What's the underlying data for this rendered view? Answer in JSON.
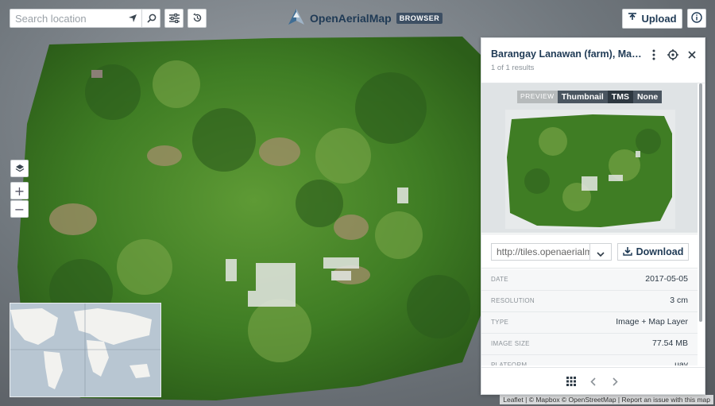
{
  "search": {
    "placeholder": "Search location"
  },
  "brand": {
    "name": "OpenAerialMap",
    "badge": "BROWSER"
  },
  "header": {
    "upload_label": "Upload"
  },
  "icons": {
    "locate": "locate-arrow-icon",
    "search": "search-icon",
    "filters": "sliders-icon",
    "history": "history-icon",
    "upload": "upload-icon",
    "info": "info-icon",
    "layers": "layers-icon",
    "zoom_in": "plus-icon",
    "zoom_out": "minus-icon",
    "more": "more-vertical-icon",
    "target": "crosshair-icon",
    "close": "close-icon",
    "grid": "grid-icon",
    "prev": "chevron-left-icon",
    "next": "chevron-right-icon",
    "dropdown": "chevron-down-icon",
    "download": "download-icon"
  },
  "map_controls": {
    "zoom_in_label": "+",
    "zoom_out_label": "−"
  },
  "panel": {
    "title": "Barangay Lanawan (farm), Mac...",
    "subtitle": "1 of 1 results",
    "preview_label": "PREVIEW",
    "preview_tabs": [
      {
        "label": "Thumbnail",
        "active": false
      },
      {
        "label": "TMS",
        "active": true
      },
      {
        "label": "None",
        "active": false
      }
    ],
    "tms_url": "http://tiles.openaerialmap.org",
    "download_label": "Download",
    "metadata": [
      {
        "key": "DATE",
        "value": "2017-05-05"
      },
      {
        "key": "RESOLUTION",
        "value": "3 cm"
      },
      {
        "key": "TYPE",
        "value": "Image + Map Layer"
      },
      {
        "key": "IMAGE SIZE",
        "value": "77.54 MB"
      },
      {
        "key": "PLATFORM",
        "value": "uav"
      }
    ]
  },
  "attribution": "Leaflet | © Mapbox © OpenStreetMap | Report an issue with this map",
  "colors": {
    "accent": "#1f3a55",
    "vegetation": "#4d8a2a",
    "badge": "#3d4f63"
  }
}
